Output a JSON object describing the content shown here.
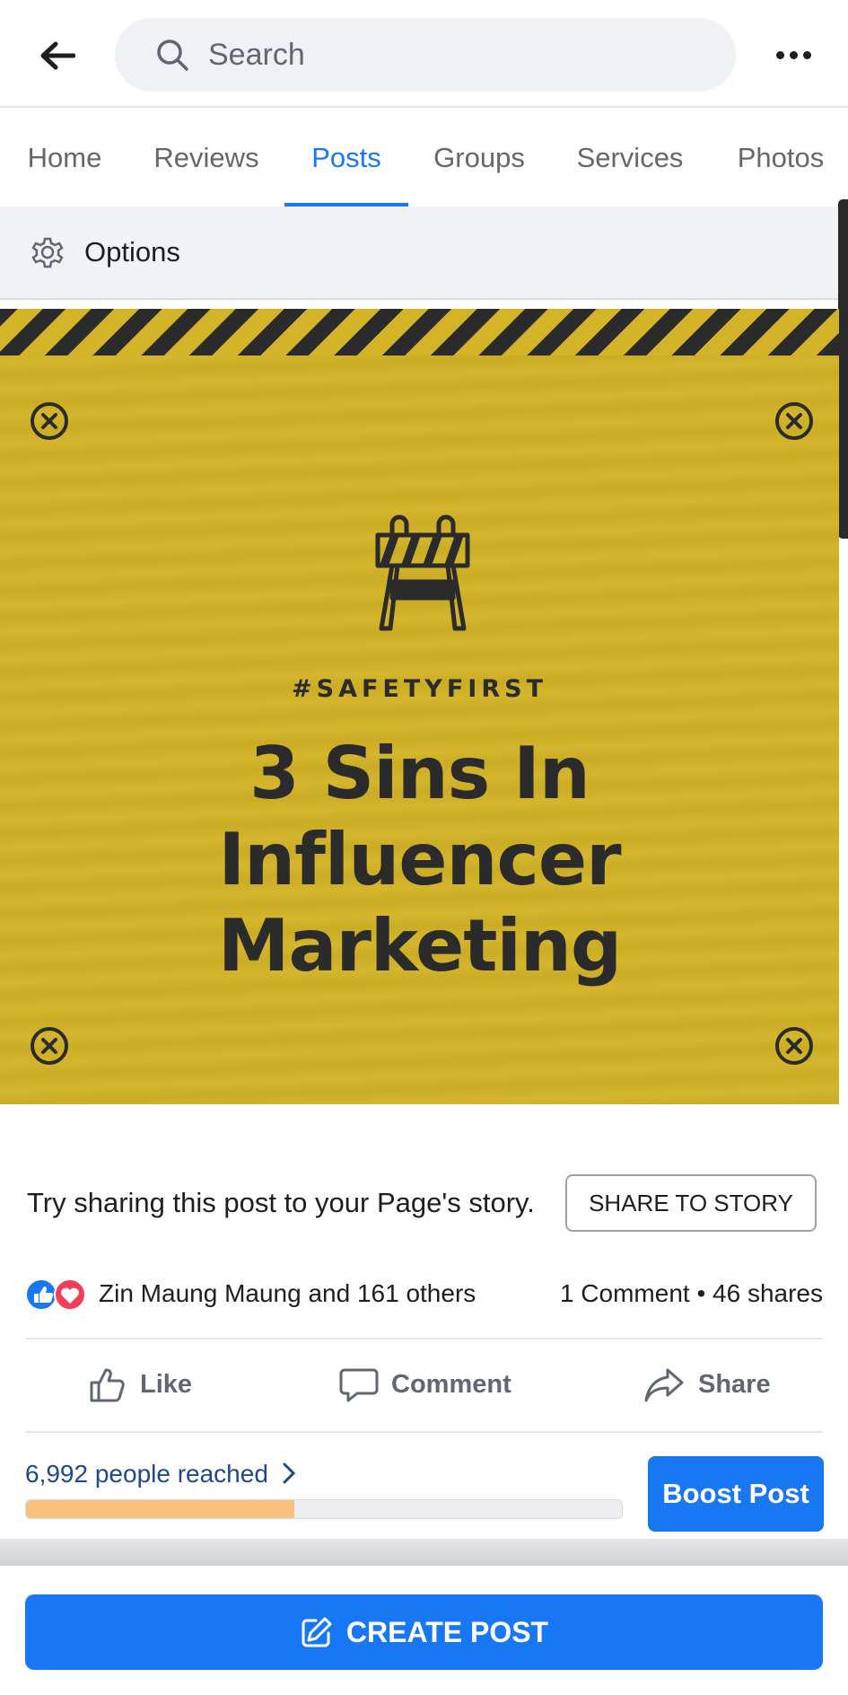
{
  "search": {
    "placeholder": "Search"
  },
  "tabs": [
    {
      "label": "Home"
    },
    {
      "label": "Reviews"
    },
    {
      "label": "Posts"
    },
    {
      "label": "Groups"
    },
    {
      "label": "Services"
    },
    {
      "label": "Photos"
    }
  ],
  "active_tab": "Posts",
  "options": {
    "label": "Options"
  },
  "post_image": {
    "hashtag": "#SAFETYFIRST",
    "headline_lines": [
      "3 Sins In",
      "Influencer",
      "Marketing"
    ],
    "background_color": "#d3b327",
    "stripe_color": "#2b2b2b"
  },
  "story": {
    "prompt": "Try sharing this post to your Page's story.",
    "button": "SHARE TO STORY"
  },
  "reactions": {
    "icons": [
      "like-icon",
      "love-icon"
    ],
    "text": "Zin Maung Maung and 161 others",
    "stats": "1 Comment • 46 shares"
  },
  "actions": {
    "like": "Like",
    "comment": "Comment",
    "share": "Share"
  },
  "reach": {
    "text": "6,992 people reached",
    "progress_fraction": 0.45,
    "boost_button": "Boost Post"
  },
  "bottom": {
    "create_post": "CREATE POST"
  },
  "colors": {
    "accent": "#1877f2",
    "love": "#f33e58",
    "progress": "#f7c27d"
  }
}
